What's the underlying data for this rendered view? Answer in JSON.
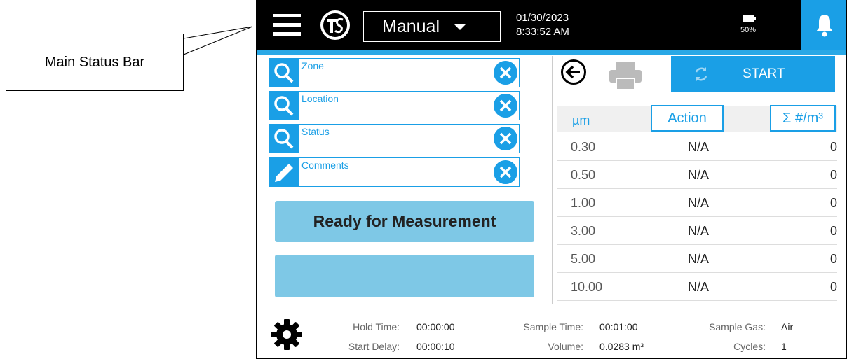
{
  "annotation": {
    "callout_label": "Main Status Bar"
  },
  "statusbar": {
    "mode": "Manual",
    "date": "01/30/2023",
    "time": "8:33:52 AM",
    "battery_percent": "50%",
    "icons": [
      "menu-icon",
      "tsi-logo",
      "chevron-down-icon",
      "battery-icon",
      "bell-icon"
    ]
  },
  "fields": [
    {
      "label": "Zone",
      "icon": "search-icon"
    },
    {
      "label": "Location",
      "icon": "search-icon"
    },
    {
      "label": "Status",
      "icon": "search-icon"
    },
    {
      "label": "Comments",
      "icon": "pencil-icon"
    }
  ],
  "status_message": "Ready for Measurement",
  "controls": {
    "start_label": "START"
  },
  "table": {
    "headers": {
      "size": "µm",
      "action": "Action",
      "sum": "Σ #/m³"
    },
    "rows": [
      {
        "size": "0.30",
        "action": "N/A",
        "count": "0"
      },
      {
        "size": "0.50",
        "action": "N/A",
        "count": "0"
      },
      {
        "size": "1.00",
        "action": "N/A",
        "count": "0"
      },
      {
        "size": "3.00",
        "action": "N/A",
        "count": "0"
      },
      {
        "size": "5.00",
        "action": "N/A",
        "count": "0"
      },
      {
        "size": "10.00",
        "action": "N/A",
        "count": "0"
      }
    ]
  },
  "footer": {
    "hold_time_label": "Hold Time:",
    "hold_time": "00:00:00",
    "start_delay_label": "Start Delay:",
    "start_delay": "00:00:10",
    "sample_time_label": "Sample Time:",
    "sample_time": "00:01:00",
    "volume_label": "Volume:",
    "volume": "0.0283 m³",
    "sample_gas_label": "Sample Gas:",
    "sample_gas": "Air",
    "cycles_label": "Cycles:",
    "cycles": "1"
  },
  "colors": {
    "accent": "#1a9fe6",
    "status_bg": "#7ec8e6",
    "bar": "#000000"
  }
}
